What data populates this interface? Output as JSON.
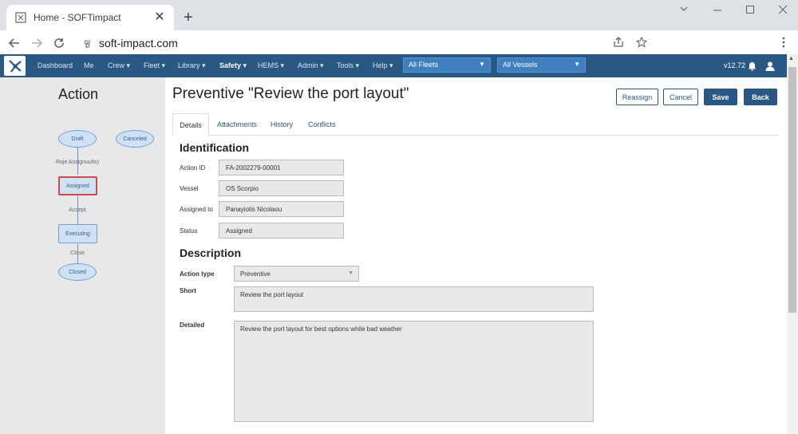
{
  "browser": {
    "tab_title": "Home - SOFTimpact",
    "tab_close": "✕",
    "new_tab": "+",
    "url": "soft-impact.com"
  },
  "navbar": {
    "items": [
      {
        "label": "Dashboard"
      },
      {
        "label": "Me"
      },
      {
        "label": "Crew ▾"
      },
      {
        "label": "Fleet ▾"
      },
      {
        "label": "Library ▾"
      },
      {
        "label": "Safety ▾"
      },
      {
        "label": "HEMS ▾"
      },
      {
        "label": "Admin ▾"
      },
      {
        "label": "Tools ▾"
      },
      {
        "label": "Help ▾"
      }
    ],
    "fleet_select": "All Fleets",
    "vessel_select": "All Vessels",
    "version": "v12.72"
  },
  "workflow": {
    "title": "Action",
    "states": {
      "draft": "Draft",
      "canceled": "Canceled",
      "assigned": "Assigned",
      "executing": "Executing",
      "closed": "Closed"
    },
    "transitions": {
      "draft_to_assigned": "Roje Assignuults)",
      "assigned_to_executing": "Accept",
      "executing_to_closed": "Close"
    },
    "current_state": "Assigned"
  },
  "main": {
    "title": "Preventive \"Review the port layout\"",
    "buttons": {
      "reassign": "Reassign",
      "cancel": "Cancel",
      "save": "Save",
      "back": "Back"
    },
    "tabs": [
      {
        "label": "Details"
      },
      {
        "label": "Attachments"
      },
      {
        "label": "History"
      },
      {
        "label": "Conflicts"
      }
    ],
    "identification": {
      "heading": "Identification",
      "action_id_label": "Action ID",
      "action_id": "FA-2002279-00001",
      "vessel_label": "Vessel",
      "vessel": "OS Scorpio",
      "assigned_to_label": "Assigned to",
      "assigned_to": "Panayiotis Nicolaou",
      "status_label": "Status",
      "status": "Assigned"
    },
    "description": {
      "heading": "Description",
      "action_type_label": "Action type",
      "action_type": "Preventive",
      "short_label": "Short",
      "short": "Review the port layout",
      "detailed_label": "Detailed",
      "detailed": "Review the port layout for best options while bad weather"
    }
  },
  "colors": {
    "navbar": "#2a5885",
    "select": "#3f7fbf",
    "current_state_border": "#d14a4a",
    "workflow_fill": "#cfe2f5"
  }
}
